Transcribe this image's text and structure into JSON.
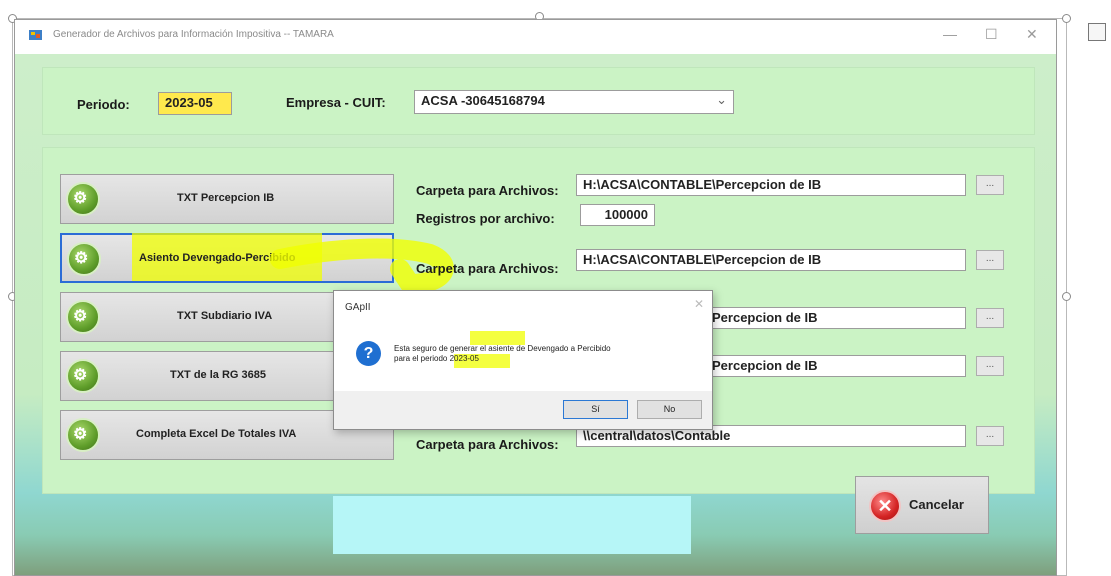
{
  "window": {
    "title": "Generador de Archivos para Información Impositiva  --  TAMARA",
    "minimize": "—",
    "maximize": "☐",
    "close": "✕"
  },
  "header": {
    "periodo_label": "Periodo:",
    "periodo_value": "2023-05",
    "empresa_label": "Empresa - CUIT:",
    "empresa_value": "ACSA  -30645168794"
  },
  "actions": [
    {
      "label": "TXT Percepcion IB"
    },
    {
      "label": "Asiento Devengado-Percibido"
    },
    {
      "label": "TXT Subdiario IVA"
    },
    {
      "label": "TXT de la RG 3685"
    },
    {
      "label": "Completa Excel De Totales IVA"
    }
  ],
  "fields": {
    "carpeta_label": "Carpeta para Archivos:",
    "registros_label": "Registros por archivo:",
    "registros_value": "100000",
    "path_1": "H:\\ACSA\\CONTABLE\\Percepcion de IB",
    "path_2": "H:\\ACSA\\CONTABLE\\Percepcion de IB",
    "path_3_partial": "Percepcion de IB",
    "path_4_partial": "Percepcion de IB",
    "path_5": "\\\\central\\datos\\Contable",
    "browse": "..."
  },
  "dialog": {
    "title": "GApII",
    "line1": "Esta seguro de generar el asiente de Devengado a Percibido",
    "line2": "para el periodo 2023-05",
    "yes": "Sí",
    "no": "No"
  },
  "cancel_label": "Cancelar",
  "icons": {
    "question": "?",
    "cancel": "✕",
    "gear": "⚙",
    "dropdown": "⌄"
  },
  "colors": {
    "panel": "#cbf3c5",
    "highlight": "#f0ff00",
    "dialog_icon": "#1f6fd1",
    "cancel_icon": "#d42424"
  }
}
